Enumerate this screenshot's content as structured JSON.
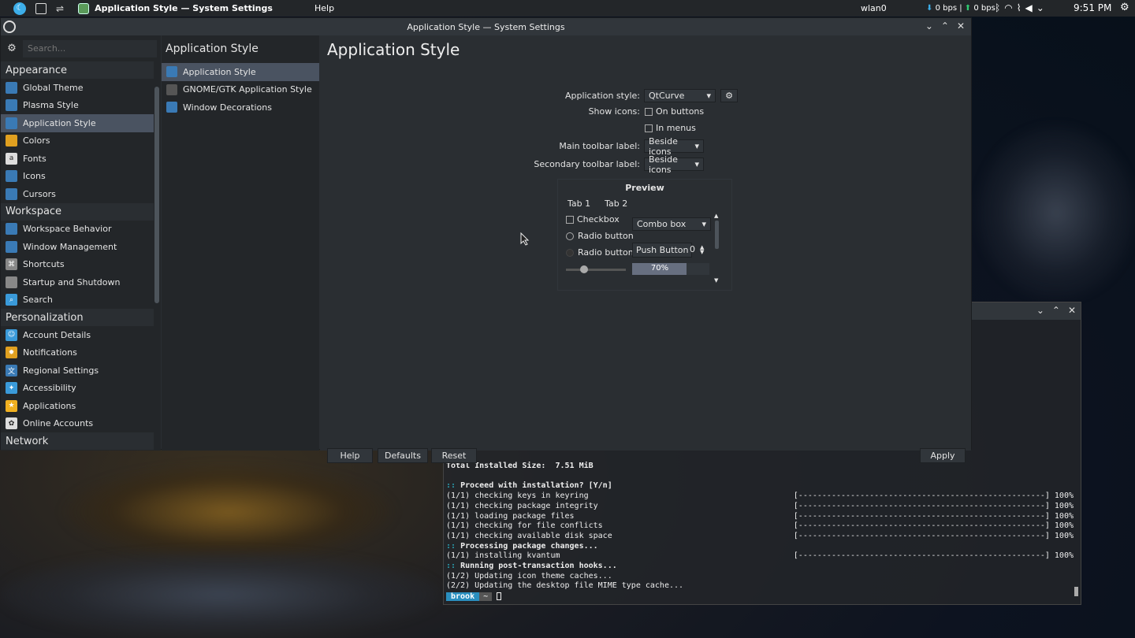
{
  "top_panel": {
    "active_window": "Application Style — System Settings",
    "menu_help": "Help",
    "network_iface": "wlan0",
    "net_down": "0 bps",
    "net_up": "0 bps",
    "time": "9:51 PM"
  },
  "window": {
    "title": "Application Style — System Settings"
  },
  "sidebar": {
    "search_placeholder": "Search...",
    "categories": [
      {
        "label": "Appearance",
        "items": [
          {
            "label": "Global Theme",
            "color": "#3a7ab5"
          },
          {
            "label": "Plasma Style",
            "color": "#3a7ab5"
          },
          {
            "label": "Application Style",
            "color": "#3a7ab5",
            "selected": true
          },
          {
            "label": "Colors",
            "color": "#e0a020"
          },
          {
            "label": "Fonts",
            "color": "#dddddd"
          },
          {
            "label": "Icons",
            "color": "#3a7ab5"
          },
          {
            "label": "Cursors",
            "color": "#3a7ab5"
          }
        ]
      },
      {
        "label": "Workspace",
        "items": [
          {
            "label": "Workspace Behavior",
            "color": "#3a7ab5"
          },
          {
            "label": "Window Management",
            "color": "#3a7ab5"
          },
          {
            "label": "Shortcuts",
            "color": "#888888"
          },
          {
            "label": "Startup and Shutdown",
            "color": "#888888"
          },
          {
            "label": "Search",
            "color": "#3a9ad9"
          }
        ]
      },
      {
        "label": "Personalization",
        "items": [
          {
            "label": "Account Details",
            "color": "#3a9ad9"
          },
          {
            "label": "Notifications",
            "color": "#e0a020"
          },
          {
            "label": "Regional Settings",
            "color": "#3a7ab5"
          },
          {
            "label": "Accessibility",
            "color": "#3a9ad9"
          },
          {
            "label": "Applications",
            "color": "#f0b020"
          },
          {
            "label": "Online Accounts",
            "color": "#dddddd"
          }
        ]
      },
      {
        "label": "Network",
        "items": []
      }
    ]
  },
  "subnav": {
    "title": "Application Style",
    "items": [
      {
        "label": "Application Style",
        "selected": true
      },
      {
        "label": "GNOME/GTK Application Style"
      },
      {
        "label": "Window Decorations"
      }
    ]
  },
  "content": {
    "title": "Application Style",
    "app_style_label": "Application style:",
    "app_style_value": "QtCurve",
    "show_icons_label": "Show icons:",
    "on_buttons": "On buttons",
    "in_menus": "In menus",
    "main_toolbar_label": "Main toolbar label:",
    "main_toolbar_value": "Beside icons",
    "secondary_toolbar_label": "Secondary toolbar label:",
    "secondary_toolbar_value": "Beside icons",
    "preview": {
      "title": "Preview",
      "tab1": "Tab 1",
      "tab2": "Tab 2",
      "checkbox": "Checkbox",
      "radio1": "Radio button",
      "radio2": "Radio button",
      "combo": "Combo box",
      "push_button": "Push Button",
      "spin_value": "0",
      "progress_label": "70%",
      "progress": 0.7,
      "slider": 0.3
    },
    "buttons": {
      "help": "Help",
      "defaults": "Defaults",
      "reset": "Reset",
      "apply": "Apply"
    }
  },
  "terminal": {
    "lines": [
      {
        "text": "Total Installed Size:  7.51 MiB",
        "bold": true,
        "gap_before": true
      },
      {
        "text": "",
        "blank": true
      },
      {
        "prefix": "::",
        "text": " Proceed with installation? [Y/n]",
        "bold": true
      },
      {
        "text": "(1/1) checking keys in keyring",
        "bar": "[----------------------------------------------------] 100%"
      },
      {
        "text": "(1/1) checking package integrity",
        "bar": "[----------------------------------------------------] 100%"
      },
      {
        "text": "(1/1) loading package files",
        "bar": "[----------------------------------------------------] 100%"
      },
      {
        "text": "(1/1) checking for file conflicts",
        "bar": "[----------------------------------------------------] 100%"
      },
      {
        "text": "(1/1) checking available disk space",
        "bar": "[----------------------------------------------------] 100%"
      },
      {
        "prefix": "::",
        "text": " Processing package changes...",
        "bold": true
      },
      {
        "text": "(1/1) installing kvantum",
        "bar": "[----------------------------------------------------] 100%"
      },
      {
        "prefix": "::",
        "text": " Running post-transaction hooks...",
        "bold": true
      },
      {
        "text": "(1/2) Updating icon theme caches..."
      },
      {
        "text": "(2/2) Updating the desktop file MIME type cache..."
      }
    ],
    "prompt_user": "brook",
    "prompt_dir": "~"
  }
}
